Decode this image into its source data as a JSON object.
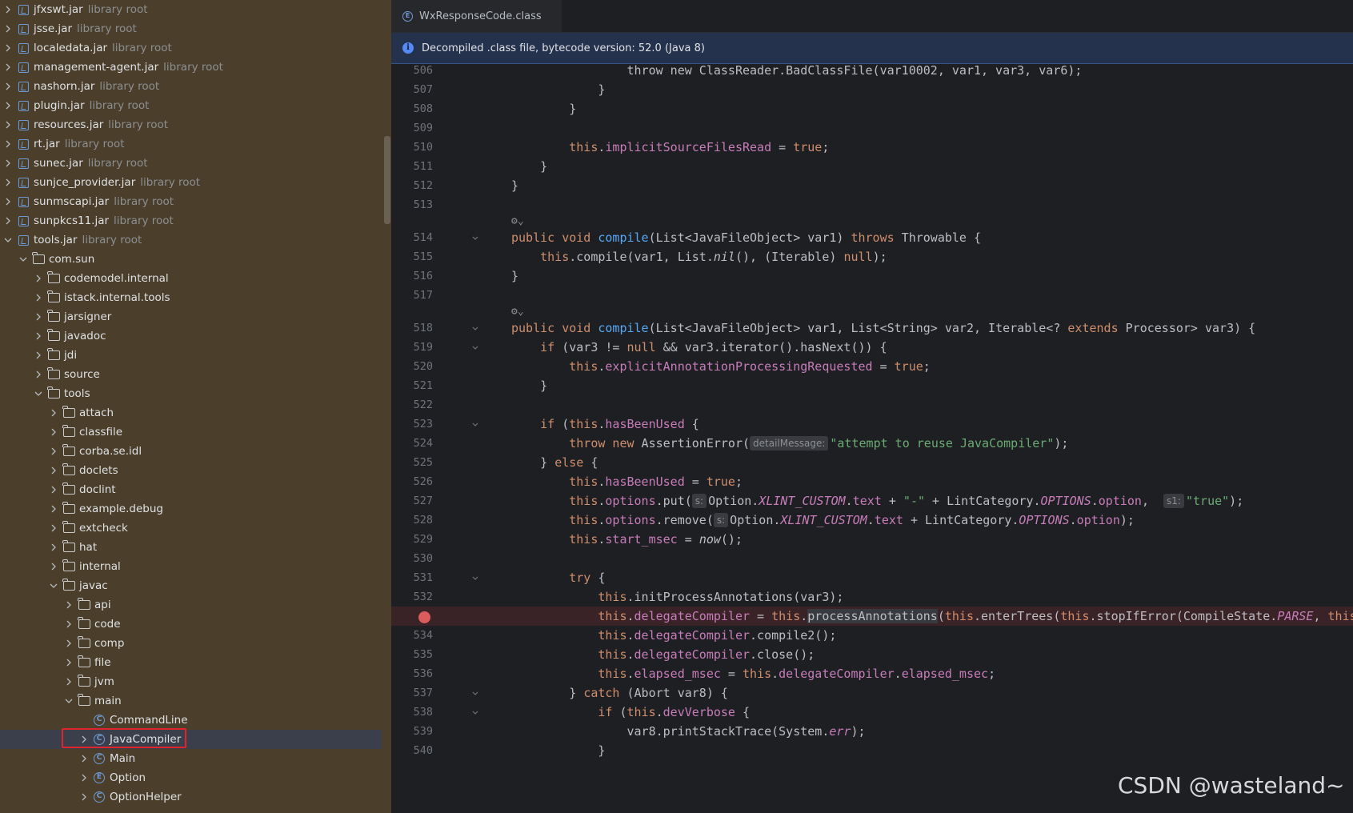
{
  "tree": {
    "items": [
      {
        "label": "jfxswt.jar",
        "suffix": "library root",
        "type": "jar",
        "depth": 0,
        "expanded": false
      },
      {
        "label": "jsse.jar",
        "suffix": "library root",
        "type": "jar",
        "depth": 0,
        "expanded": false
      },
      {
        "label": "localedata.jar",
        "suffix": "library root",
        "type": "jar",
        "depth": 0,
        "expanded": false
      },
      {
        "label": "management-agent.jar",
        "suffix": "library root",
        "type": "jar",
        "depth": 0,
        "expanded": false
      },
      {
        "label": "nashorn.jar",
        "suffix": "library root",
        "type": "jar",
        "depth": 0,
        "expanded": false
      },
      {
        "label": "plugin.jar",
        "suffix": "library root",
        "type": "jar",
        "depth": 0,
        "expanded": false
      },
      {
        "label": "resources.jar",
        "suffix": "library root",
        "type": "jar",
        "depth": 0,
        "expanded": false
      },
      {
        "label": "rt.jar",
        "suffix": "library root",
        "type": "jar",
        "depth": 0,
        "expanded": false
      },
      {
        "label": "sunec.jar",
        "suffix": "library root",
        "type": "jar",
        "depth": 0,
        "expanded": false
      },
      {
        "label": "sunjce_provider.jar",
        "suffix": "library root",
        "type": "jar",
        "depth": 0,
        "expanded": false
      },
      {
        "label": "sunmscapi.jar",
        "suffix": "library root",
        "type": "jar",
        "depth": 0,
        "expanded": false
      },
      {
        "label": "sunpkcs11.jar",
        "suffix": "library root",
        "type": "jar",
        "depth": 0,
        "expanded": false
      },
      {
        "label": "tools.jar",
        "suffix": "library root",
        "type": "jar",
        "depth": 0,
        "expanded": true
      },
      {
        "label": "com.sun",
        "type": "folder",
        "depth": 1,
        "expanded": true
      },
      {
        "label": "codemodel.internal",
        "type": "folder",
        "depth": 2,
        "expanded": false
      },
      {
        "label": "istack.internal.tools",
        "type": "folder",
        "depth": 2,
        "expanded": false
      },
      {
        "label": "jarsigner",
        "type": "folder",
        "depth": 2,
        "expanded": false
      },
      {
        "label": "javadoc",
        "type": "folder",
        "depth": 2,
        "expanded": false
      },
      {
        "label": "jdi",
        "type": "folder",
        "depth": 2,
        "expanded": false
      },
      {
        "label": "source",
        "type": "folder",
        "depth": 2,
        "expanded": false
      },
      {
        "label": "tools",
        "type": "folder",
        "depth": 2,
        "expanded": true
      },
      {
        "label": "attach",
        "type": "folder",
        "depth": 3,
        "expanded": false
      },
      {
        "label": "classfile",
        "type": "folder",
        "depth": 3,
        "expanded": false
      },
      {
        "label": "corba.se.idl",
        "type": "folder",
        "depth": 3,
        "expanded": false
      },
      {
        "label": "doclets",
        "type": "folder",
        "depth": 3,
        "expanded": false
      },
      {
        "label": "doclint",
        "type": "folder",
        "depth": 3,
        "expanded": false
      },
      {
        "label": "example.debug",
        "type": "folder",
        "depth": 3,
        "expanded": false
      },
      {
        "label": "extcheck",
        "type": "folder",
        "depth": 3,
        "expanded": false
      },
      {
        "label": "hat",
        "type": "folder",
        "depth": 3,
        "expanded": false
      },
      {
        "label": "internal",
        "type": "folder",
        "depth": 3,
        "expanded": false
      },
      {
        "label": "javac",
        "type": "folder",
        "depth": 3,
        "expanded": true
      },
      {
        "label": "api",
        "type": "folder",
        "depth": 4,
        "expanded": false
      },
      {
        "label": "code",
        "type": "folder",
        "depth": 4,
        "expanded": false
      },
      {
        "label": "comp",
        "type": "folder",
        "depth": 4,
        "expanded": false
      },
      {
        "label": "file",
        "type": "folder",
        "depth": 4,
        "expanded": false
      },
      {
        "label": "jvm",
        "type": "folder",
        "depth": 4,
        "expanded": false
      },
      {
        "label": "main",
        "type": "folder",
        "depth": 4,
        "expanded": true
      },
      {
        "label": "CommandLine",
        "type": "class",
        "depth": 5,
        "leaf": true
      },
      {
        "label": "JavaCompiler",
        "type": "class",
        "depth": 5,
        "expanded": false,
        "selected": true
      },
      {
        "label": "Main",
        "type": "class",
        "depth": 5,
        "expanded": false
      },
      {
        "label": "Option",
        "type": "enum",
        "depth": 5,
        "expanded": false
      },
      {
        "label": "OptionHelper",
        "type": "class",
        "depth": 5,
        "expanded": false
      }
    ]
  },
  "editor": {
    "tab": {
      "label": "WxResponseCode.class",
      "icon": "class-icon"
    },
    "banner": {
      "text": "Decompiled .class file, bytecode version: 52.0 (Java 8)",
      "icon": "info-icon"
    },
    "lines": [
      {
        "n": "506",
        "code": [
          [
            "",
            "                throw new ClassReader.BadClassFile(var10002, var1, var3, var6);"
          ]
        ]
      },
      {
        "n": "507",
        "code": [
          [
            "",
            "            }"
          ]
        ]
      },
      {
        "n": "508",
        "code": [
          [
            "",
            "        }"
          ]
        ]
      },
      {
        "n": "509",
        "code": [
          [
            "",
            ""
          ]
        ]
      },
      {
        "n": "510",
        "code": [
          [
            "",
            "        "
          ],
          [
            "kw",
            "this"
          ],
          [
            "",
            "."
          ],
          [
            "fld",
            "implicitSourceFilesRead"
          ],
          [
            "",
            " = "
          ],
          [
            "kw",
            "true"
          ],
          [
            "",
            ";"
          ]
        ]
      },
      {
        "n": "511",
        "code": [
          [
            "",
            "    }"
          ]
        ]
      },
      {
        "n": "512",
        "code": [
          [
            "",
            "}"
          ]
        ]
      },
      {
        "n": "513",
        "code": [
          [
            "",
            ""
          ]
        ]
      },
      {
        "n": "",
        "annot": true
      },
      {
        "n": "514",
        "fold": true,
        "code": [
          [
            "kw",
            "public void "
          ],
          [
            "fn",
            "compile"
          ],
          [
            "",
            "(List<JavaFileObject> var1) "
          ],
          [
            "kw",
            "throws"
          ],
          [
            "",
            " Throwable {"
          ]
        ]
      },
      {
        "n": "515",
        "code": [
          [
            "",
            "    "
          ],
          [
            "kw",
            "this"
          ],
          [
            "",
            ".compile(var1, List."
          ],
          [
            "ital",
            "nil"
          ],
          [
            "",
            "(), (Iterable) "
          ],
          [
            "kw",
            "null"
          ],
          [
            "",
            ");"
          ]
        ]
      },
      {
        "n": "516",
        "code": [
          [
            "",
            "}"
          ]
        ]
      },
      {
        "n": "517",
        "code": [
          [
            "",
            ""
          ]
        ]
      },
      {
        "n": "",
        "annot": true
      },
      {
        "n": "518",
        "fold": true,
        "code": [
          [
            "kw",
            "public void "
          ],
          [
            "fn",
            "compile"
          ],
          [
            "",
            "(List<JavaFileObject> var1, List<String> var2, Iterable<? "
          ],
          [
            "kw",
            "extends"
          ],
          [
            "",
            " Processor> var3) {"
          ]
        ]
      },
      {
        "n": "519",
        "fold": true,
        "code": [
          [
            "",
            "    "
          ],
          [
            "kw",
            "if"
          ],
          [
            "",
            " (var3 != "
          ],
          [
            "kw",
            "null"
          ],
          [
            "",
            " && var3.iterator().hasNext()) {"
          ]
        ]
      },
      {
        "n": "520",
        "code": [
          [
            "",
            "        "
          ],
          [
            "kw",
            "this"
          ],
          [
            "",
            "."
          ],
          [
            "fld",
            "explicitAnnotationProcessingRequested"
          ],
          [
            "",
            " = "
          ],
          [
            "kw",
            "true"
          ],
          [
            "",
            ";"
          ]
        ]
      },
      {
        "n": "521",
        "code": [
          [
            "",
            "    }"
          ]
        ]
      },
      {
        "n": "522",
        "code": [
          [
            "",
            ""
          ]
        ]
      },
      {
        "n": "523",
        "fold": true,
        "code": [
          [
            "",
            "    "
          ],
          [
            "kw",
            "if"
          ],
          [
            "",
            " ("
          ],
          [
            "kw",
            "this"
          ],
          [
            "",
            "."
          ],
          [
            "fld",
            "hasBeenUsed"
          ],
          [
            "",
            " {"
          ]
        ]
      },
      {
        "n": "524",
        "code": [
          [
            "",
            "        "
          ],
          [
            "kw",
            "throw new"
          ],
          [
            "",
            " AssertionError("
          ],
          [
            "hint",
            "detailMessage:"
          ],
          [
            "st",
            "\"attempt to reuse JavaCompiler\""
          ],
          [
            "",
            ");"
          ]
        ]
      },
      {
        "n": "525",
        "code": [
          [
            "",
            "    } "
          ],
          [
            "kw",
            "else"
          ],
          [
            "",
            " {"
          ]
        ]
      },
      {
        "n": "526",
        "code": [
          [
            "",
            "        "
          ],
          [
            "kw",
            "this"
          ],
          [
            "",
            "."
          ],
          [
            "fld",
            "hasBeenUsed"
          ],
          [
            "",
            " = "
          ],
          [
            "kw",
            "true"
          ],
          [
            "",
            ";"
          ]
        ]
      },
      {
        "n": "527",
        "code": [
          [
            "",
            "        "
          ],
          [
            "kw",
            "this"
          ],
          [
            "",
            "."
          ],
          [
            "fld",
            "options"
          ],
          [
            "",
            ".put("
          ],
          [
            "hint",
            "s:"
          ],
          [
            "",
            "Option."
          ],
          [
            "sf",
            "XLINT_CUSTOM"
          ],
          [
            "",
            "."
          ],
          [
            "fld",
            "text"
          ],
          [
            "",
            " + "
          ],
          [
            "st",
            "\"-\""
          ],
          [
            "",
            " + LintCategory."
          ],
          [
            "sf",
            "OPTIONS"
          ],
          [
            "",
            "."
          ],
          [
            "fld",
            "option"
          ],
          [
            "",
            ",  "
          ],
          [
            "hint",
            "s1:"
          ],
          [
            "st",
            "\"true\""
          ],
          [
            "",
            ");"
          ]
        ]
      },
      {
        "n": "528",
        "code": [
          [
            "",
            "        "
          ],
          [
            "kw",
            "this"
          ],
          [
            "",
            "."
          ],
          [
            "fld",
            "options"
          ],
          [
            "",
            ".remove("
          ],
          [
            "hint",
            "s:"
          ],
          [
            "",
            "Option."
          ],
          [
            "sf",
            "XLINT_CUSTOM"
          ],
          [
            "",
            "."
          ],
          [
            "fld",
            "text"
          ],
          [
            "",
            " + LintCategory."
          ],
          [
            "sf",
            "OPTIONS"
          ],
          [
            "",
            "."
          ],
          [
            "fld",
            "option"
          ],
          [
            "",
            ");"
          ]
        ]
      },
      {
        "n": "529",
        "code": [
          [
            "",
            "        "
          ],
          [
            "kw",
            "this"
          ],
          [
            "",
            "."
          ],
          [
            "fld",
            "start_msec"
          ],
          [
            "",
            " = "
          ],
          [
            "ital",
            "now"
          ],
          [
            "",
            "();"
          ]
        ]
      },
      {
        "n": "530",
        "code": [
          [
            "",
            ""
          ]
        ]
      },
      {
        "n": "531",
        "fold": true,
        "code": [
          [
            "",
            "        "
          ],
          [
            "kw",
            "try"
          ],
          [
            "",
            " {"
          ]
        ]
      },
      {
        "n": "532",
        "code": [
          [
            "",
            "            "
          ],
          [
            "kw",
            "this"
          ],
          [
            "",
            ".initProcessAnnotations(var3);"
          ]
        ]
      },
      {
        "n": "",
        "breakpoint": true,
        "code": [
          [
            "",
            "            "
          ],
          [
            "kw",
            "this"
          ],
          [
            "",
            "."
          ],
          [
            "fld",
            "delegateCompiler"
          ],
          [
            "",
            " = "
          ],
          [
            "kw",
            "this"
          ],
          [
            "",
            "."
          ],
          [
            "dup",
            "processAnnotations"
          ],
          [
            "",
            "("
          ],
          [
            "kw",
            "this"
          ],
          [
            "",
            ".enterTrees("
          ],
          [
            "kw",
            "this"
          ],
          [
            "",
            ".stopIfError(CompileState."
          ],
          [
            "sf",
            "PARSE"
          ],
          [
            "",
            ", "
          ],
          [
            "kw",
            "this"
          ]
        ]
      },
      {
        "n": "534",
        "code": [
          [
            "",
            "            "
          ],
          [
            "kw",
            "this"
          ],
          [
            "",
            "."
          ],
          [
            "fld",
            "delegateCompiler"
          ],
          [
            "",
            ".compile2();"
          ]
        ]
      },
      {
        "n": "535",
        "code": [
          [
            "",
            "            "
          ],
          [
            "kw",
            "this"
          ],
          [
            "",
            "."
          ],
          [
            "fld",
            "delegateCompiler"
          ],
          [
            "",
            ".close();"
          ]
        ]
      },
      {
        "n": "536",
        "code": [
          [
            "",
            "            "
          ],
          [
            "kw",
            "this"
          ],
          [
            "",
            "."
          ],
          [
            "fld",
            "elapsed_msec"
          ],
          [
            "",
            " = "
          ],
          [
            "kw",
            "this"
          ],
          [
            "",
            "."
          ],
          [
            "fld",
            "delegateCompiler"
          ],
          [
            "",
            "."
          ],
          [
            "fld",
            "elapsed_msec"
          ],
          [
            "",
            ";"
          ]
        ]
      },
      {
        "n": "537",
        "fold": true,
        "code": [
          [
            "",
            "        } "
          ],
          [
            "kw",
            "catch"
          ],
          [
            "",
            " (Abort var8) {"
          ]
        ]
      },
      {
        "n": "538",
        "fold": true,
        "code": [
          [
            "",
            "            "
          ],
          [
            "kw",
            "if"
          ],
          [
            "",
            " ("
          ],
          [
            "kw",
            "this"
          ],
          [
            "",
            "."
          ],
          [
            "fld",
            "devVerbose"
          ],
          [
            "",
            " {"
          ]
        ]
      },
      {
        "n": "539",
        "code": [
          [
            "",
            "                var8.printStackTrace(System."
          ],
          [
            "sf",
            "err"
          ],
          [
            "",
            ");"
          ]
        ]
      },
      {
        "n": "540",
        "code": [
          [
            "",
            "            }"
          ]
        ]
      }
    ]
  },
  "watermark": "CSDN @wasteland~"
}
